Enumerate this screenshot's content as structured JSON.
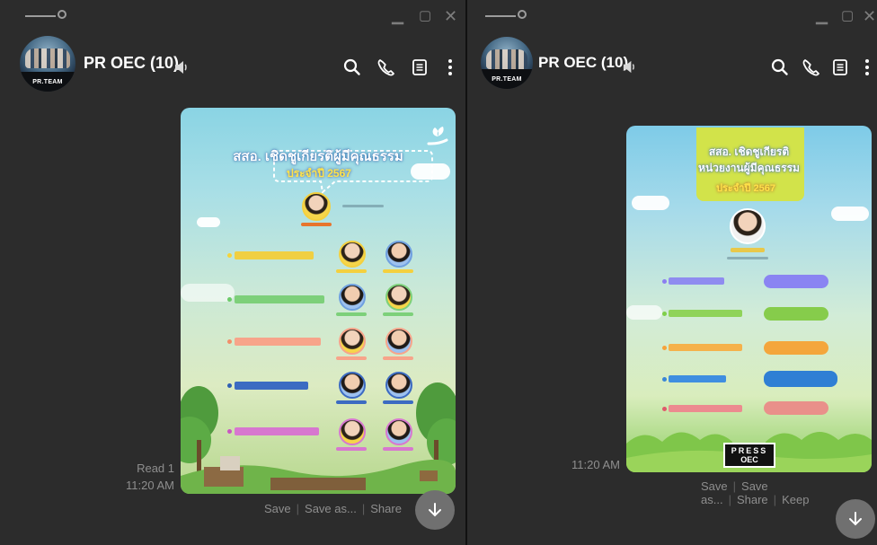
{
  "left_window": {
    "chat": {
      "title": "PR OEC (10)",
      "avatar_tag": "PR.TEAM"
    },
    "message": {
      "read_status": "Read 1",
      "time": "11:20 AM"
    },
    "actions": [
      "Save",
      "Save as...",
      "Share"
    ],
    "poster": {
      "headline": "สสอ. เชิดชูเกียรติผู้มีคุณธรรม",
      "year": "ประจำปี 2567"
    }
  },
  "right_window": {
    "chat": {
      "title": "PR OEC (10)",
      "avatar_tag": "PR.TEAM"
    },
    "message": {
      "time": "11:20 AM"
    },
    "actions": [
      "Save",
      "Save as...",
      "Share",
      "Keep"
    ],
    "poster": {
      "headline_1": "สสอ. เชิดชูเกียรติ",
      "headline_2": "หน่วยงานผู้มีคุณธรรม",
      "year": "ประจำปี 2567",
      "press_logo_1": "PRESS",
      "press_logo_2": "OEC"
    }
  },
  "colors": {
    "window_bg": "#2c2c2c",
    "text_primary": "#ffffff",
    "text_meta": "#8e8e8e",
    "fab": "#707070"
  }
}
